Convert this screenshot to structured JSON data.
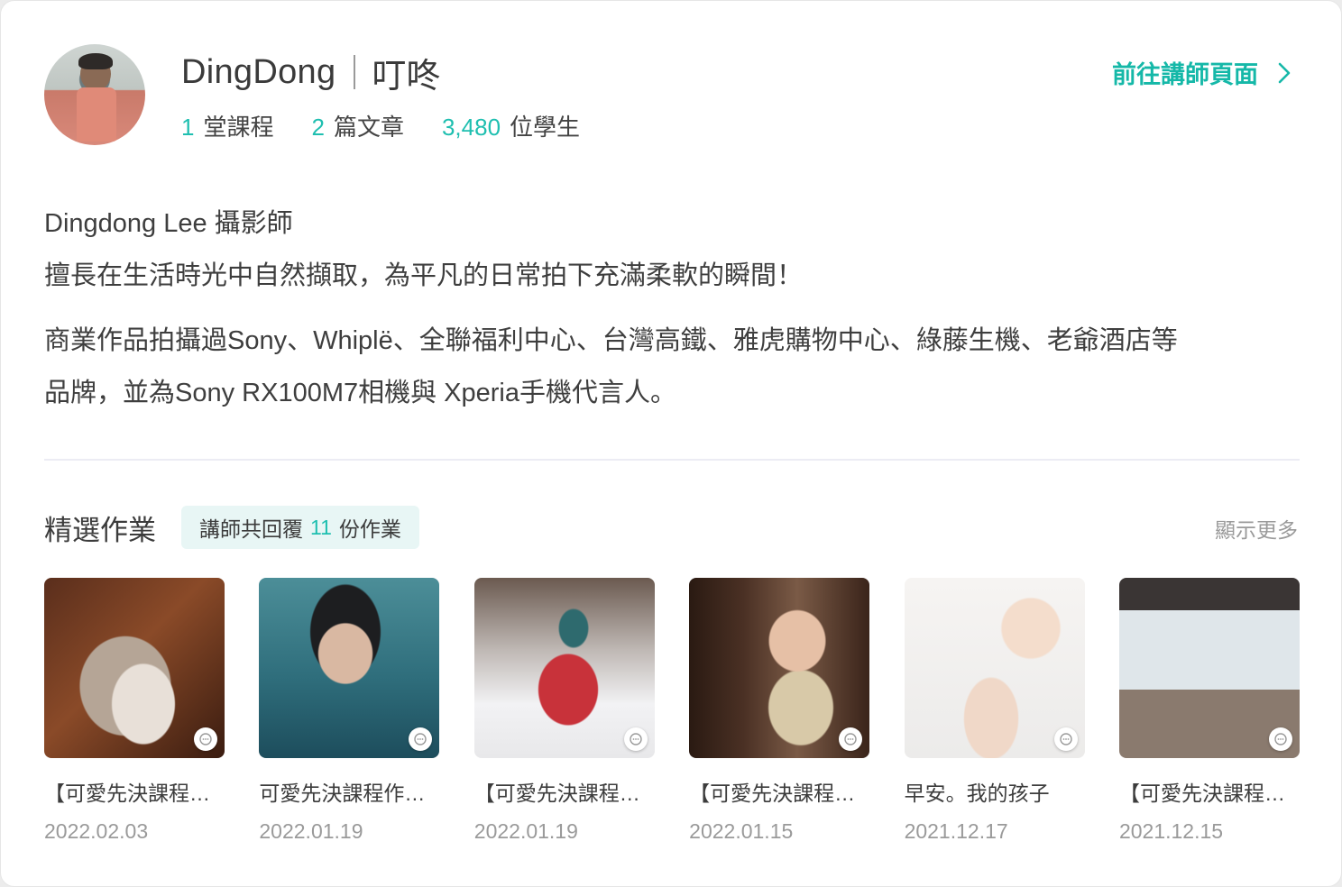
{
  "profile": {
    "name_en": "DingDong",
    "name_zh": "叮咚",
    "stats": [
      {
        "num": "1",
        "label": "堂課程"
      },
      {
        "num": "2",
        "label": "篇文章"
      },
      {
        "num": "3,480",
        "label": "位學生"
      }
    ],
    "teacher_link": "前往講師頁面",
    "bio_line1": "Dingdong Lee 攝影師",
    "bio_line2": "擅長在生活時光中自然擷取，為平凡的日常拍下充滿柔軟的瞬間！",
    "bio_line3": "商業作品拍攝過Sony、Whiplë、全聯福利中心、台灣高鐵、雅虎購物中心、綠藤生機、老爺酒店等",
    "bio_line4": "品牌，並為Sony RX100M7相機與 Xperia手機代言人。"
  },
  "featured": {
    "title": "精選作業",
    "badge_prefix": "講師共回覆",
    "badge_count": "11",
    "badge_suffix": "份作業",
    "show_more": "顯示更多",
    "items": [
      {
        "title": "【可愛先決課程…",
        "date": "2022.02.03"
      },
      {
        "title": "可愛先決課程作…",
        "date": "2022.01.19"
      },
      {
        "title": "【可愛先決課程…",
        "date": "2022.01.19"
      },
      {
        "title": "【可愛先決課程…",
        "date": "2022.01.15"
      },
      {
        "title": "早安。我的孩子",
        "date": "2021.12.17"
      },
      {
        "title": "【可愛先決課程…",
        "date": "2021.12.15"
      }
    ]
  },
  "colors": {
    "accent": "#1fbfb0",
    "link": "#15b8a8",
    "badge_bg": "#e8f6f5"
  }
}
